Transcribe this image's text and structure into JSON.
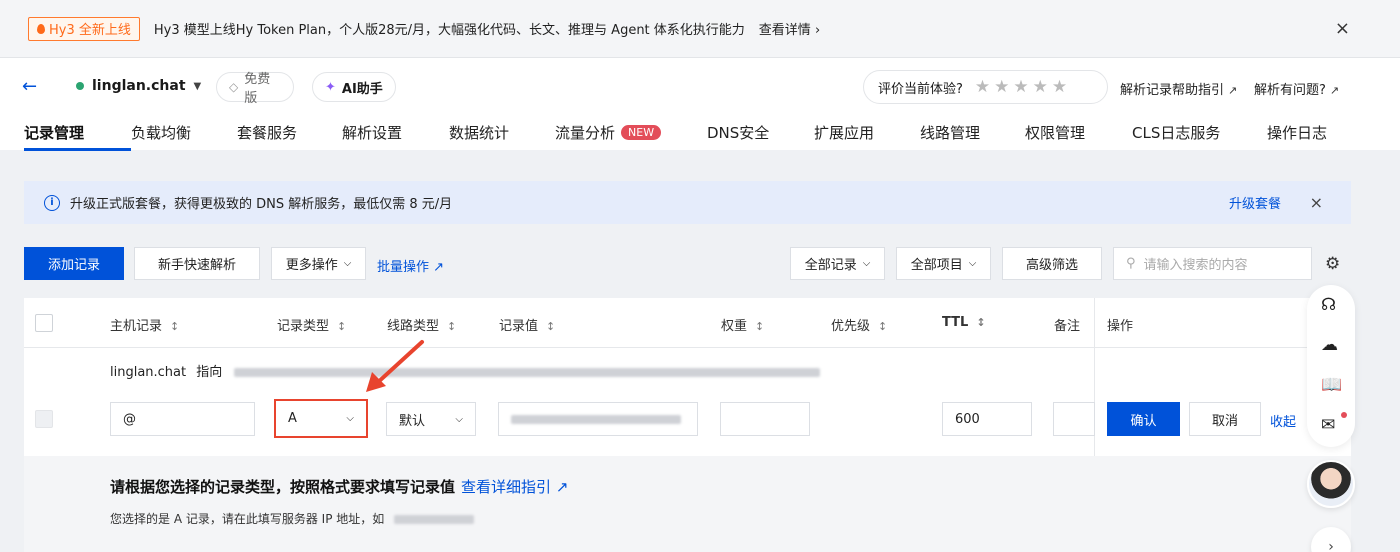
{
  "announcement": {
    "badge": "Hy3 全新上线",
    "message": "Hy3 模型上线Hy Token Plan，个人版28元/月，大幅强化代码、长文、推理与 Agent 体系化执行能力",
    "more_link": "查看详情",
    "close_icon": "×"
  },
  "header": {
    "back_icon": "←",
    "domain": "linglan.chat",
    "plan_badge": "免费版",
    "ai_button": "AI助手",
    "rating_label": "评价当前体验?",
    "rating_stars": "★★★★★",
    "help_link": "解析记录帮助指引",
    "issue_link": "解析有问题?"
  },
  "tabs": [
    {
      "label": "记录管理"
    },
    {
      "label": "负载均衡"
    },
    {
      "label": "套餐服务"
    },
    {
      "label": "解析设置"
    },
    {
      "label": "数据统计"
    },
    {
      "label": "流量分析",
      "badge": "NEW"
    },
    {
      "label": "DNS安全"
    },
    {
      "label": "扩展应用"
    },
    {
      "label": "线路管理"
    },
    {
      "label": "权限管理"
    },
    {
      "label": "CLS日志服务"
    },
    {
      "label": "操作日志"
    }
  ],
  "banner": {
    "text": "升级正式版套餐，获得更极致的 DNS 解析服务，最低仅需 8 元/月",
    "action": "升级套餐",
    "close_icon": "×"
  },
  "toolbar": {
    "add_record": "添加记录",
    "quick_setup": "新手快速解析",
    "more_actions": "更多操作",
    "batch": "批量操作",
    "filter_records": "全部记录",
    "filter_projects": "全部项目",
    "advanced_filter": "高级筛选",
    "search_placeholder": "请输入搜索的内容"
  },
  "table": {
    "headers": [
      "主机记录",
      "记录类型",
      "线路类型",
      "记录值",
      "权重",
      "优先级",
      "TTL",
      "备注",
      "操作"
    ],
    "points_to_domain": "linglan.chat",
    "points_to_label": "指向",
    "row": {
      "host": "@",
      "type": "A",
      "line": "默认",
      "ttl": "600",
      "confirm": "确认",
      "cancel": "取消",
      "collapse": "收起"
    },
    "hint_title": "请根据您选择的记录类型，按照格式要求填写记录值",
    "hint_link": "查看详细指引",
    "hint_detail": "您选择的是 A 记录，请在此填写服务器 IP 地址，如"
  },
  "colors": {
    "primary": "#0052d9",
    "accent_orange": "#ff6a1a",
    "badge_red": "#e34d59",
    "arrow_red": "#e8442e"
  }
}
